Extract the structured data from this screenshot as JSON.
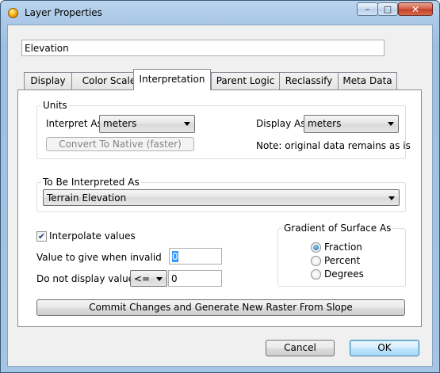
{
  "window": {
    "title": "Layer Properties",
    "minimize_glyph": "–",
    "maximize_glyph": "□",
    "close_glyph": "✕"
  },
  "layer_name": {
    "value": "Elevation"
  },
  "tabs": [
    {
      "label": "Display",
      "active": false
    },
    {
      "label": "Color Scale",
      "active": false
    },
    {
      "label": "Interpretation",
      "active": true
    },
    {
      "label": "Parent Logic",
      "active": false
    },
    {
      "label": "Reclassify",
      "active": false
    },
    {
      "label": "Meta Data",
      "active": false
    }
  ],
  "units": {
    "group_label": "Units",
    "interpret_as_label": "Interpret As",
    "interpret_as_value": "meters",
    "display_as_label": "Display As",
    "display_as_value": "meters",
    "convert_button": "Convert To Native (faster)",
    "note": "Note: original data remains as is"
  },
  "interpreted": {
    "group_label": "To Be Interpreted As",
    "value": "Terrain Elevation"
  },
  "interpolate": {
    "label": "Interpolate values",
    "checked": true,
    "check_glyph": "✔"
  },
  "invalid_value": {
    "label": "Value to give when invalid",
    "value": "0"
  },
  "do_not_display": {
    "label": "Do not display values",
    "operator": "<=",
    "value": "0"
  },
  "gradient": {
    "group_label": "Gradient of Surface As",
    "options": [
      {
        "label": "Fraction",
        "checked": true
      },
      {
        "label": "Percent",
        "checked": false
      },
      {
        "label": "Degrees",
        "checked": false
      }
    ]
  },
  "commit_button": "Commit Changes and Generate New Raster From Slope",
  "footer": {
    "cancel": "Cancel",
    "ok": "OK"
  }
}
